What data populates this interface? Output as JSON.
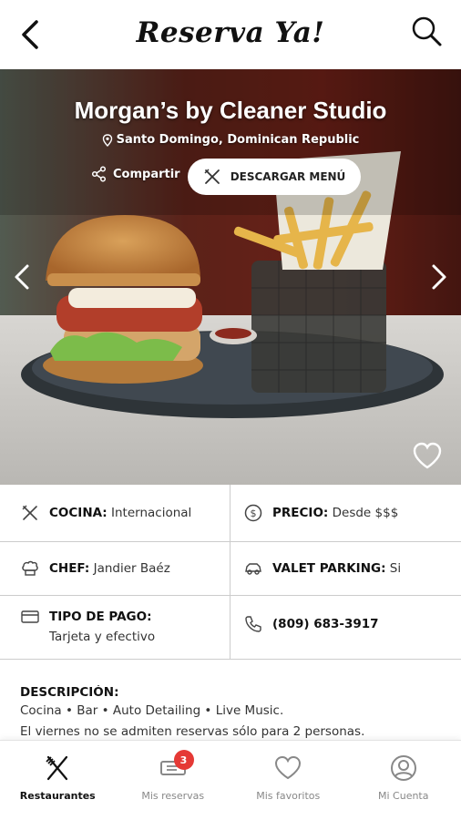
{
  "header": {
    "title": "Reserva Ya!"
  },
  "restaurant": {
    "name": "Morgan’s by Cleaner Studio",
    "location": "Santo Domingo, Dominican Republic",
    "share_label": "Compartir",
    "menu_button_label": "DESCARGAR MENÚ"
  },
  "info": {
    "cocina": {
      "label": "COCINA:",
      "value": "Internacional"
    },
    "precio": {
      "label": "PRECIO:",
      "value": "Desde $$$"
    },
    "chef": {
      "label": "CHEF:",
      "value": "Jandier Baéz"
    },
    "valet": {
      "label": "VALET PARKING:",
      "value": "Si"
    },
    "pago": {
      "label": "TIPO DE PAGO:",
      "value": "Tarjeta y efectivo"
    },
    "telefono": {
      "value": "(809) 683-3917"
    }
  },
  "description": {
    "heading": "DESCRIPCIÓN:",
    "line1": "Cocina • Bar • Auto Detailing • Live Music.",
    "line2": "El viernes no se admiten reservas sólo para 2 personas."
  },
  "nav": {
    "items": [
      {
        "label": "Restaurantes",
        "icon": "cutlery-icon",
        "active": true
      },
      {
        "label": "Mis reservas",
        "icon": "ticket-icon",
        "badge": "3"
      },
      {
        "label": "Mis favoritos",
        "icon": "heart-icon"
      },
      {
        "label": "Mi Cuenta",
        "icon": "user-icon"
      }
    ]
  },
  "colors": {
    "badge": "#e53935",
    "text": "#222222"
  }
}
